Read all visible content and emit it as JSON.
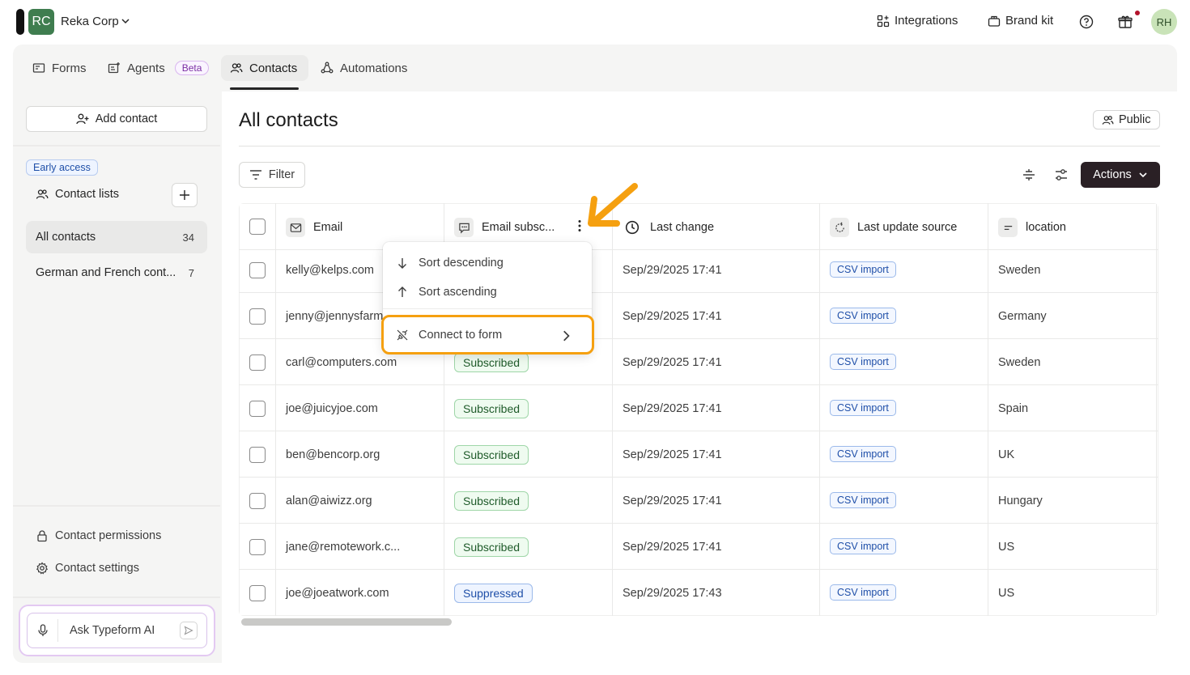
{
  "topbar": {
    "org_initials": "RC",
    "org_name": "Reka Corp",
    "integrations": "Integrations",
    "brand_kit": "Brand kit",
    "user_initials": "RH"
  },
  "nav": {
    "tabs": [
      {
        "label": "Forms"
      },
      {
        "label": "Agents",
        "badge": "Beta"
      },
      {
        "label": "Contacts",
        "active": true
      },
      {
        "label": "Automations"
      }
    ]
  },
  "sidebar": {
    "add_contact": "Add contact",
    "early_access": "Early access",
    "contact_lists": "Contact lists",
    "lists": [
      {
        "label": "All contacts",
        "count": "34",
        "active": true
      },
      {
        "label": "German and French cont...",
        "count": "7"
      }
    ],
    "contact_permissions": "Contact permissions",
    "contact_settings": "Contact settings",
    "ai_placeholder": "Ask Typeform AI"
  },
  "main": {
    "title": "All contacts",
    "public_label": "Public",
    "filter_label": "Filter",
    "actions_label": "Actions",
    "columns": [
      "Email",
      "Email subsc...",
      "Last change",
      "Last update source",
      "location"
    ],
    "rows": [
      {
        "email": "kelly@kelps.com",
        "status": "",
        "last_change": "Sep/29/2025 17:41",
        "source": "CSV import",
        "location": "Sweden"
      },
      {
        "email": "jenny@jennysfarm",
        "status": "",
        "last_change": "Sep/29/2025 17:41",
        "source": "CSV import",
        "location": "Germany"
      },
      {
        "email": "carl@computers.com",
        "status": "Subscribed",
        "last_change": "Sep/29/2025 17:41",
        "source": "CSV import",
        "location": "Sweden"
      },
      {
        "email": "joe@juicyjoe.com",
        "status": "Subscribed",
        "last_change": "Sep/29/2025 17:41",
        "source": "CSV import",
        "location": "Spain"
      },
      {
        "email": "ben@bencorp.org",
        "status": "Subscribed",
        "last_change": "Sep/29/2025 17:41",
        "source": "CSV import",
        "location": "UK"
      },
      {
        "email": "alan@aiwizz.org",
        "status": "Subscribed",
        "last_change": "Sep/29/2025 17:41",
        "source": "CSV import",
        "location": "Hungary"
      },
      {
        "email": "jane@remotework.c...",
        "status": "Subscribed",
        "last_change": "Sep/29/2025 17:41",
        "source": "CSV import",
        "location": "US"
      },
      {
        "email": "joe@joeatwork.com",
        "status": "Suppressed",
        "last_change": "Sep/29/2025 17:43",
        "source": "CSV import",
        "location": "US"
      }
    ]
  },
  "menu": {
    "sort_desc": "Sort descending",
    "sort_asc": "Sort ascending",
    "connect": "Connect to form"
  },
  "colors": {
    "accent_dark": "#2a2025",
    "highlight": "#f5a010",
    "org_green": "#3f7d4f"
  }
}
